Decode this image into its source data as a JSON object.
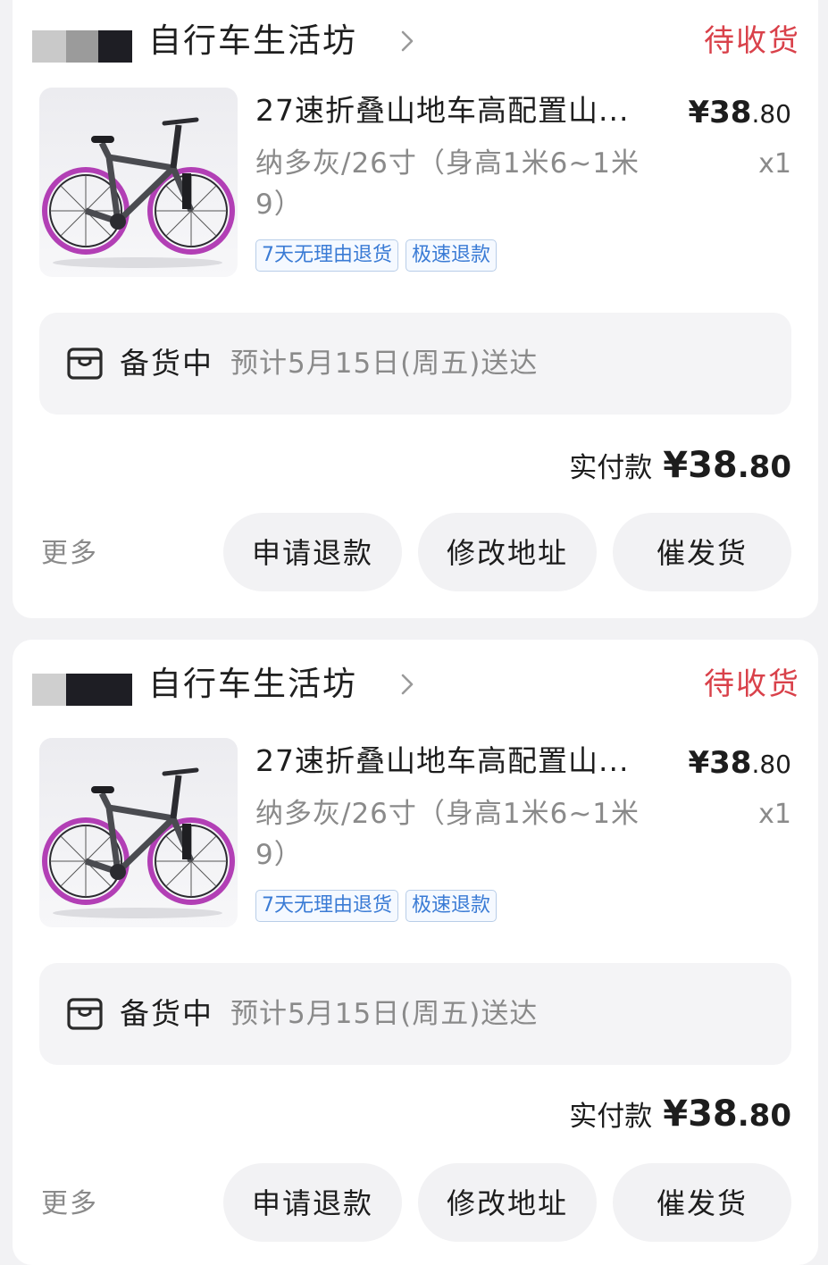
{
  "orders": [
    {
      "shop_name": "自行车生活坊",
      "status": "待收货",
      "product": {
        "title": "27速折叠山地车高配置山...",
        "spec": "纳多灰/26寸（身高1米6~1米9）",
        "price_int": "¥38",
        "price_dec": ".80",
        "qty": "x1",
        "tags": [
          "7天无理由退货",
          "极速退款"
        ]
      },
      "logistics": {
        "status": "备货中",
        "eta": "预计5月15日(周五)送达"
      },
      "paid_label": "实付款",
      "paid_int": "¥38",
      "paid_dec": ".80",
      "more": "更多",
      "buttons": [
        "申请退款",
        "修改地址",
        "催发货"
      ]
    },
    {
      "shop_name": "自行车生活坊",
      "status": "待收货",
      "product": {
        "title": "27速折叠山地车高配置山...",
        "spec": "纳多灰/26寸（身高1米6~1米9）",
        "price_int": "¥38",
        "price_dec": ".80",
        "qty": "x1",
        "tags": [
          "7天无理由退货",
          "极速退款"
        ]
      },
      "logistics": {
        "status": "备货中",
        "eta": "预计5月15日(周五)送达"
      },
      "paid_label": "实付款",
      "paid_int": "¥38",
      "paid_dec": ".80",
      "more": "更多",
      "buttons": [
        "申请退款",
        "修改地址",
        "催发货"
      ]
    }
  ],
  "colors": {
    "status": "#d9414a",
    "tag": "#3a7bd5",
    "card_bg": "#ffffff",
    "page_bg": "#f2f2f4"
  },
  "icons": {
    "chevron": "chevron-right-icon",
    "box": "package-box-icon",
    "thumb": "bicycle-image"
  }
}
